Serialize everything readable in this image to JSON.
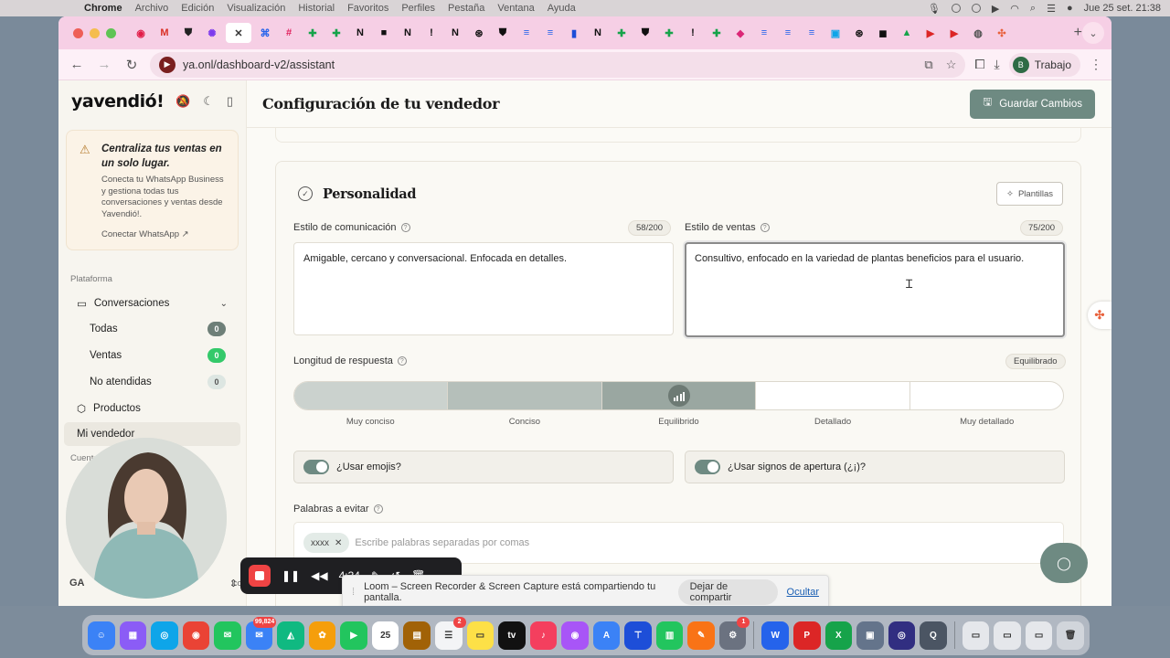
{
  "menubar": {
    "app": "Chrome",
    "items": [
      "Archivo",
      "Edición",
      "Visualización",
      "Historial",
      "Favoritos",
      "Perfiles",
      "Pestaña",
      "Ventana",
      "Ayuda"
    ],
    "datetime": "Jue 25 set.  21:38"
  },
  "browser": {
    "url": "ya.onl/dashboard-v2/assistant",
    "profile_initial": "B",
    "profile_name": "Trabajo",
    "tabs": [
      {
        "icon": "record-icon",
        "color": "#e11d48",
        "glyph": "◉"
      },
      {
        "icon": "gmail-icon",
        "color": "#d93025",
        "glyph": "M"
      },
      {
        "icon": "shield-icon",
        "color": "#222222",
        "glyph": "⛊"
      },
      {
        "icon": "gear-icon",
        "color": "#7c3aed",
        "glyph": "✺"
      },
      {
        "icon": "close-tab-icon",
        "color": "#333333",
        "glyph": "✕"
      },
      {
        "icon": "app-blue-icon",
        "color": "#2563eb",
        "glyph": "⌘"
      },
      {
        "icon": "slack-icon",
        "color": "#e01e5a",
        "glyph": "#"
      },
      {
        "icon": "sheets-icon",
        "color": "#16a34a",
        "glyph": "✚"
      },
      {
        "icon": "sheets-icon",
        "color": "#16a34a",
        "glyph": "✚"
      },
      {
        "icon": "notion-icon",
        "color": "#111111",
        "glyph": "N"
      },
      {
        "icon": "ai-icon",
        "color": "#111111",
        "glyph": "■"
      },
      {
        "icon": "notion-icon",
        "color": "#111111",
        "glyph": "N"
      },
      {
        "icon": "exclaim-icon",
        "color": "#111111",
        "glyph": "!"
      },
      {
        "icon": "notion-icon",
        "color": "#111111",
        "glyph": "N"
      },
      {
        "icon": "openai-icon",
        "color": "#111111",
        "glyph": "⊛"
      },
      {
        "icon": "shield-icon",
        "color": "#111111",
        "glyph": "⛊"
      },
      {
        "icon": "docs-icon",
        "color": "#2563eb",
        "glyph": "≡"
      },
      {
        "icon": "docs-icon",
        "color": "#2563eb",
        "glyph": "≡"
      },
      {
        "icon": "book-icon",
        "color": "#1d4ed8",
        "glyph": "▮"
      },
      {
        "icon": "notion-icon",
        "color": "#111111",
        "glyph": "N"
      },
      {
        "icon": "sheets-icon",
        "color": "#16a34a",
        "glyph": "✚"
      },
      {
        "icon": "shield-icon",
        "color": "#111111",
        "glyph": "⛊"
      },
      {
        "icon": "sheets-icon",
        "color": "#16a34a",
        "glyph": "✚"
      },
      {
        "icon": "exclaim-icon",
        "color": "#111111",
        "glyph": "!"
      },
      {
        "icon": "sheets-icon",
        "color": "#16a34a",
        "glyph": "✚"
      },
      {
        "icon": "colorful-icon",
        "color": "#db2777",
        "glyph": "◆"
      },
      {
        "icon": "docs-icon",
        "color": "#2563eb",
        "glyph": "≡"
      },
      {
        "icon": "docs-icon",
        "color": "#2563eb",
        "glyph": "≡"
      },
      {
        "icon": "docs-icon",
        "color": "#2563eb",
        "glyph": "≡"
      },
      {
        "icon": "photo-icon",
        "color": "#0ea5e9",
        "glyph": "▣"
      },
      {
        "icon": "openai-icon",
        "color": "#111111",
        "glyph": "⊛"
      },
      {
        "icon": "pocket-icon",
        "color": "#111111",
        "glyph": "◼"
      },
      {
        "icon": "drive-icon",
        "color": "#16a34a",
        "glyph": "▲"
      },
      {
        "icon": "youtube-icon",
        "color": "#dc2626",
        "glyph": "▶"
      },
      {
        "icon": "youtube-icon",
        "color": "#dc2626",
        "glyph": "▶"
      },
      {
        "icon": "globe-icon",
        "color": "#555555",
        "glyph": "◍"
      },
      {
        "icon": "hubspot-icon",
        "color": "#e8613c",
        "glyph": "✣"
      }
    ]
  },
  "sidebar": {
    "logo": "yavendió!",
    "promo": {
      "title": "Centraliza tus ventas en un solo lugar.",
      "text": "Conecta tu WhatsApp Business y gestiona todas tus conversaciones y ventas desde Yavendió!.",
      "link": "Conectar WhatsApp"
    },
    "section_platform": "Plataforma",
    "conversations": "Conversaciones",
    "sub_items": [
      {
        "label": "Todas",
        "count": "0"
      },
      {
        "label": "Ventas",
        "count": "0"
      },
      {
        "label": "No atendidas",
        "count": "0"
      }
    ],
    "products": "Productos",
    "my_seller": "Mi vendedor",
    "section_account": "Cuenta",
    "user_initials": "GA",
    "user_email_fragment": ".com"
  },
  "main": {
    "title": "Configuración de tu vendedor",
    "save_label": "Guardar Cambios",
    "personality": {
      "title": "Personalidad",
      "templates_label": "Plantillas",
      "comm_style_label": "Estilo de comunicación",
      "comm_style_count": "58/200",
      "comm_style_value": "Amigable, cercano y conversacional. Enfocada en detalles.",
      "sales_style_label": "Estilo de ventas",
      "sales_style_count": "75/200",
      "sales_style_value": "Consultivo, enfocado en la variedad de plantas beneficios para el usuario.",
      "length_label": "Longitud de respuesta",
      "length_value": "Equilibrado",
      "length_level": 3,
      "length_options": [
        "Muy conciso",
        "Conciso",
        "Equilibrido",
        "Detallado",
        "Muy detallado"
      ],
      "emoji_label": "¿Usar emojis?",
      "emoji_on": true,
      "opening_marks_label": "¿Usar signos de apertura (¿¡)?",
      "opening_marks_on": true,
      "avoid_words_label": "Palabras a evitar",
      "avoid_chip": "xxxx",
      "avoid_placeholder": "Escribe palabras separadas por comas"
    }
  },
  "loom": {
    "timer": "4:34",
    "share_text": "Loom – Screen Recorder & Screen Capture está compartiendo tu pantalla.",
    "stop_label": "Dejar de compartir",
    "hide_label": "Ocultar"
  },
  "dock": [
    {
      "icon": "finder-icon",
      "color": "#3b82f6",
      "glyph": "☺"
    },
    {
      "icon": "launchpad-icon",
      "color": "#8b5cf6",
      "glyph": "▦"
    },
    {
      "icon": "safari-icon",
      "color": "#0ea5e9",
      "glyph": "◎"
    },
    {
      "icon": "chrome-icon",
      "color": "#ea4335",
      "glyph": "◉"
    },
    {
      "icon": "messages-icon",
      "color": "#22c55e",
      "glyph": "✉"
    },
    {
      "icon": "mail-icon",
      "color": "#3b82f6",
      "glyph": "✉",
      "badge": "99,824"
    },
    {
      "icon": "maps-icon",
      "color": "#10b981",
      "glyph": "◭"
    },
    {
      "icon": "photos-icon",
      "color": "#f59e0b",
      "glyph": "✿"
    },
    {
      "icon": "facetime-icon",
      "color": "#22c55e",
      "glyph": "▶"
    },
    {
      "icon": "calendar-icon",
      "color": "#ffffff",
      "glyph": "25"
    },
    {
      "icon": "notes-brown-icon",
      "color": "#a16207",
      "glyph": "▤"
    },
    {
      "icon": "reminders-icon",
      "color": "#f3f4f6",
      "glyph": "☰",
      "badge": "2"
    },
    {
      "icon": "notes-icon",
      "color": "#fde047",
      "glyph": "▭"
    },
    {
      "icon": "tv-icon",
      "color": "#111111",
      "glyph": "tv"
    },
    {
      "icon": "music-icon",
      "color": "#f43f5e",
      "glyph": "♪"
    },
    {
      "icon": "podcasts-icon",
      "color": "#a855f7",
      "glyph": "◉"
    },
    {
      "icon": "appstore-icon",
      "color": "#3b82f6",
      "glyph": "A"
    },
    {
      "icon": "keynote-icon",
      "color": "#1d4ed8",
      "glyph": "⊤"
    },
    {
      "icon": "numbers-icon",
      "color": "#22c55e",
      "glyph": "▥"
    },
    {
      "icon": "pages-icon",
      "color": "#f97316",
      "glyph": "✎"
    },
    {
      "icon": "settings-icon",
      "color": "#6b7280",
      "glyph": "⚙",
      "badge": "1"
    },
    {
      "icon": "word-icon",
      "color": "#2563eb",
      "glyph": "W"
    },
    {
      "icon": "powerpoint-icon",
      "color": "#dc2626",
      "glyph": "P"
    },
    {
      "icon": "excel-icon",
      "color": "#16a34a",
      "glyph": "X"
    },
    {
      "icon": "preview-icon",
      "color": "#64748b",
      "glyph": "▣"
    },
    {
      "icon": "obs-icon",
      "color": "#312e81",
      "glyph": "◎"
    },
    {
      "icon": "quicktime-icon",
      "color": "#4b5563",
      "glyph": "Q"
    },
    {
      "icon": "window-icon",
      "color": "#e5e7eb",
      "glyph": "▭"
    },
    {
      "icon": "window-icon",
      "color": "#e5e7eb",
      "glyph": "▭"
    },
    {
      "icon": "window-icon",
      "color": "#e5e7eb",
      "glyph": "▭"
    },
    {
      "icon": "trash-icon",
      "color": "#d1d5db",
      "glyph": "🗑"
    }
  ]
}
